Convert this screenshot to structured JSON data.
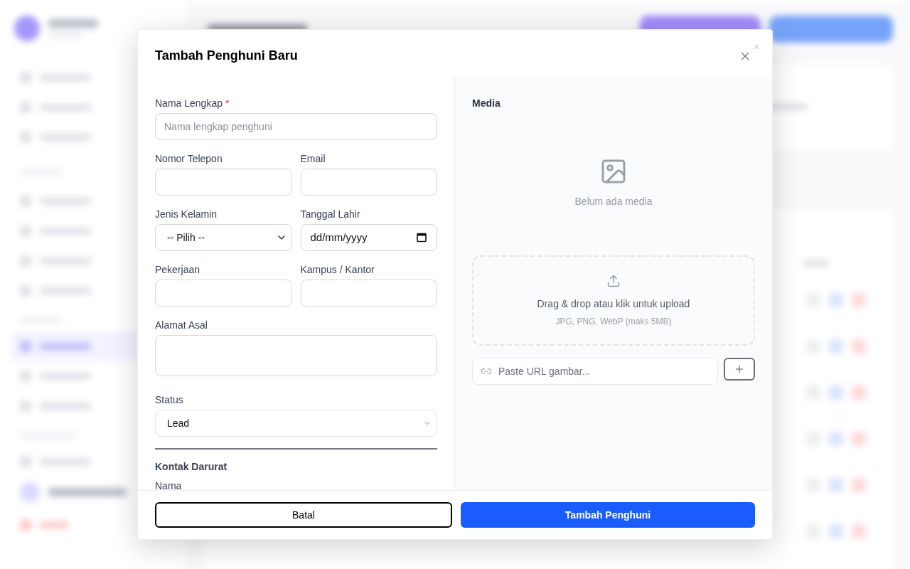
{
  "dialog": {
    "title": "Tambah Penghuni Baru"
  },
  "form": {
    "rows": [
      {
        "fields": [
          {
            "kind": "text",
            "label": "Nama Lengkap",
            "required_mark": "*",
            "placeholder": "Nama lengkap penghuni"
          }
        ]
      },
      {
        "fields": [
          {
            "kind": "text",
            "label": "Nomor Telepon"
          },
          {
            "kind": "text",
            "label": "Email"
          }
        ]
      },
      {
        "fields": [
          {
            "kind": "select",
            "label": "Jenis Kelamin",
            "value": "-- Pilih --"
          },
          {
            "kind": "date",
            "label": "Tanggal Lahir",
            "value": "dd/mm/yyyy"
          }
        ]
      },
      {
        "fields": [
          {
            "kind": "text",
            "label": "Pekerjaan"
          },
          {
            "kind": "text",
            "label": "Kampus / Kantor"
          }
        ]
      },
      {
        "fields": [
          {
            "kind": "textarea",
            "label": "Alamat Asal"
          }
        ]
      },
      {
        "fields": [
          {
            "kind": "select",
            "label": "Status",
            "value": "Lead"
          }
        ]
      }
    ],
    "section": {
      "title": "Kontak Darurat",
      "next_label": "Nama"
    }
  },
  "media": {
    "label": "Media",
    "empty_text": "Belum ada media",
    "dropzone": {
      "text": "Drag & drop atau klik untuk upload",
      "hint": "JPG, PNG, WebP (maks 5MB)"
    },
    "url_field": {
      "placeholder": "Paste URL gambar..."
    }
  },
  "footer": {
    "buttons": [
      {
        "kind": "secondary",
        "label": "Batal"
      },
      {
        "kind": "primary",
        "label": "Tambah Penghuni"
      }
    ]
  }
}
